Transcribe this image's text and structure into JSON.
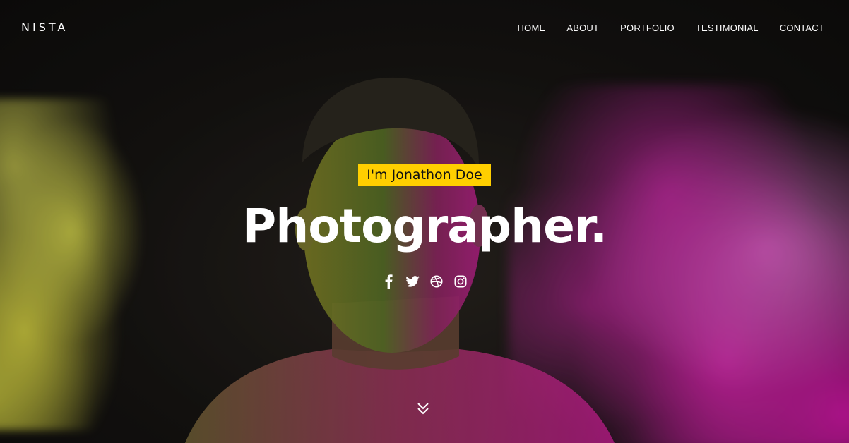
{
  "brand": "NISTA",
  "nav": {
    "items": [
      {
        "label": "HOME"
      },
      {
        "label": "ABOUT"
      },
      {
        "label": "PORTFOLIO"
      },
      {
        "label": "TESTIMONIAL"
      },
      {
        "label": "CONTACT"
      }
    ]
  },
  "hero": {
    "intro": "I'm Jonathon Doe",
    "headline": "Photographer.",
    "social_icons": [
      "facebook-icon",
      "twitter-icon",
      "dribbble-icon",
      "instagram-icon"
    ],
    "scroll_icon": "double-chevron-down-icon"
  },
  "colors": {
    "accent": "#ffcf00",
    "text": "#ffffff",
    "powder_left": "#e3e35a",
    "powder_right": "#d81fb0"
  }
}
